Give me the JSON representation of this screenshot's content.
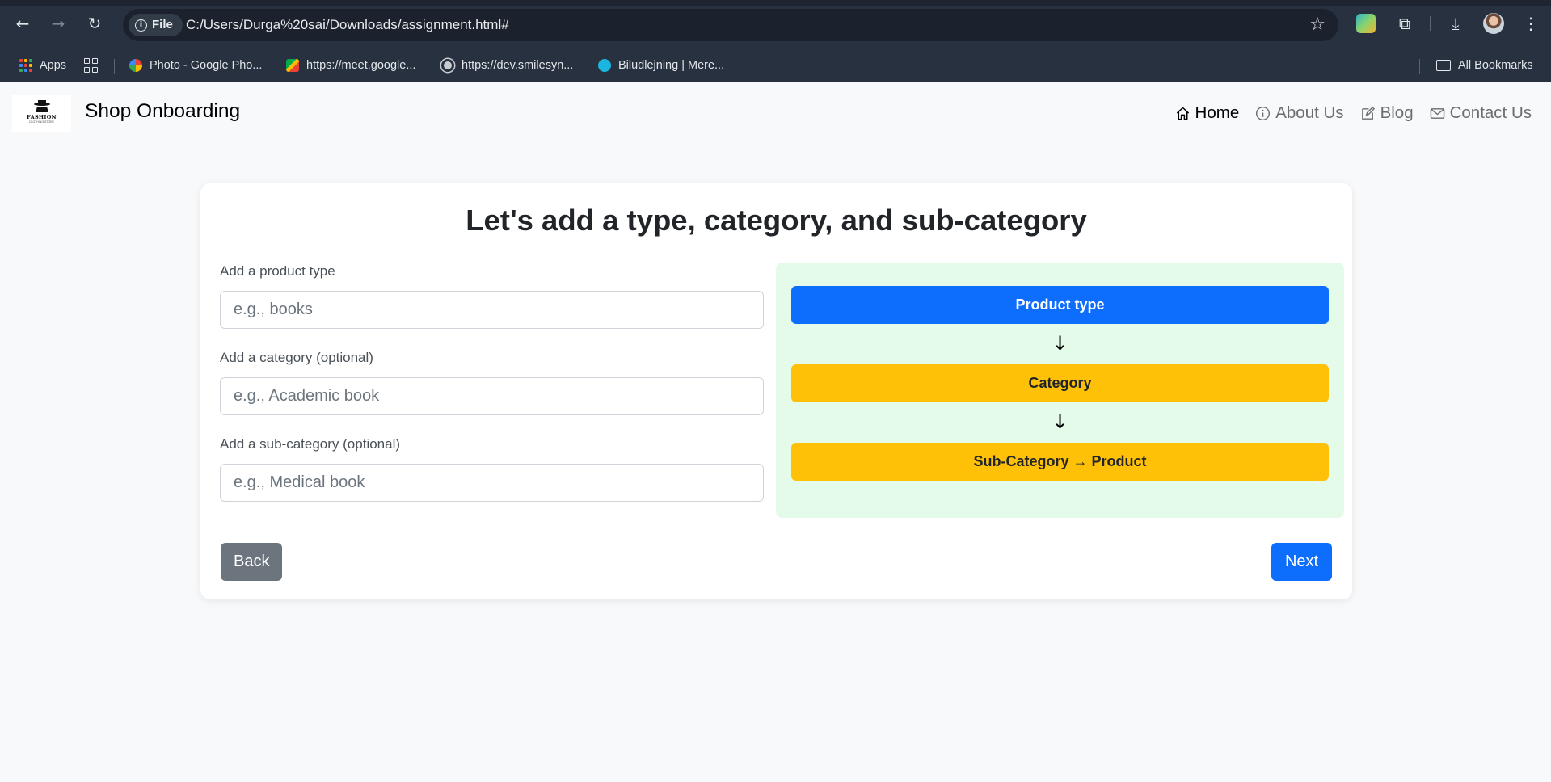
{
  "browser": {
    "url_chip": "File",
    "url": "C:/Users/Durga%20sai/Downloads/assignment.html#",
    "bookmarks": [
      {
        "label": "Apps"
      },
      {
        "label": "Photo - Google Pho..."
      },
      {
        "label": "https://meet.google..."
      },
      {
        "label": "https://dev.smilesyn..."
      },
      {
        "label": "Biludlejning | Mere..."
      }
    ],
    "all_bookmarks": "All Bookmarks"
  },
  "site": {
    "logo_text": "FASHION",
    "logo_sub": "CLOTHING STORE",
    "brand": "Shop Onboarding",
    "nav": [
      {
        "label": "Home",
        "icon": "home-icon",
        "active": true
      },
      {
        "label": "About Us",
        "icon": "info-circle-icon"
      },
      {
        "label": "Blog",
        "icon": "edit-icon"
      },
      {
        "label": "Contact Us",
        "icon": "envelope-icon"
      }
    ]
  },
  "form": {
    "title": "Let's add a type, category, and sub-category",
    "fields": [
      {
        "label": "Add a product type",
        "placeholder": "e.g., books",
        "value": ""
      },
      {
        "label": "Add a category (optional)",
        "placeholder": "e.g., Academic book",
        "value": ""
      },
      {
        "label": "Add a sub-category (optional)",
        "placeholder": "e.g., Medical book",
        "value": ""
      }
    ],
    "back_label": "Back",
    "next_label": "Next"
  },
  "hierarchy": {
    "levels": [
      "Product type",
      "Category",
      "Sub-Category → Product"
    ],
    "arrow": "↓",
    "colors": {
      "product_type": "#0d6efd",
      "category": "#ffc107",
      "sub_category": "#ffc107",
      "panel": "#e4fbea"
    }
  }
}
